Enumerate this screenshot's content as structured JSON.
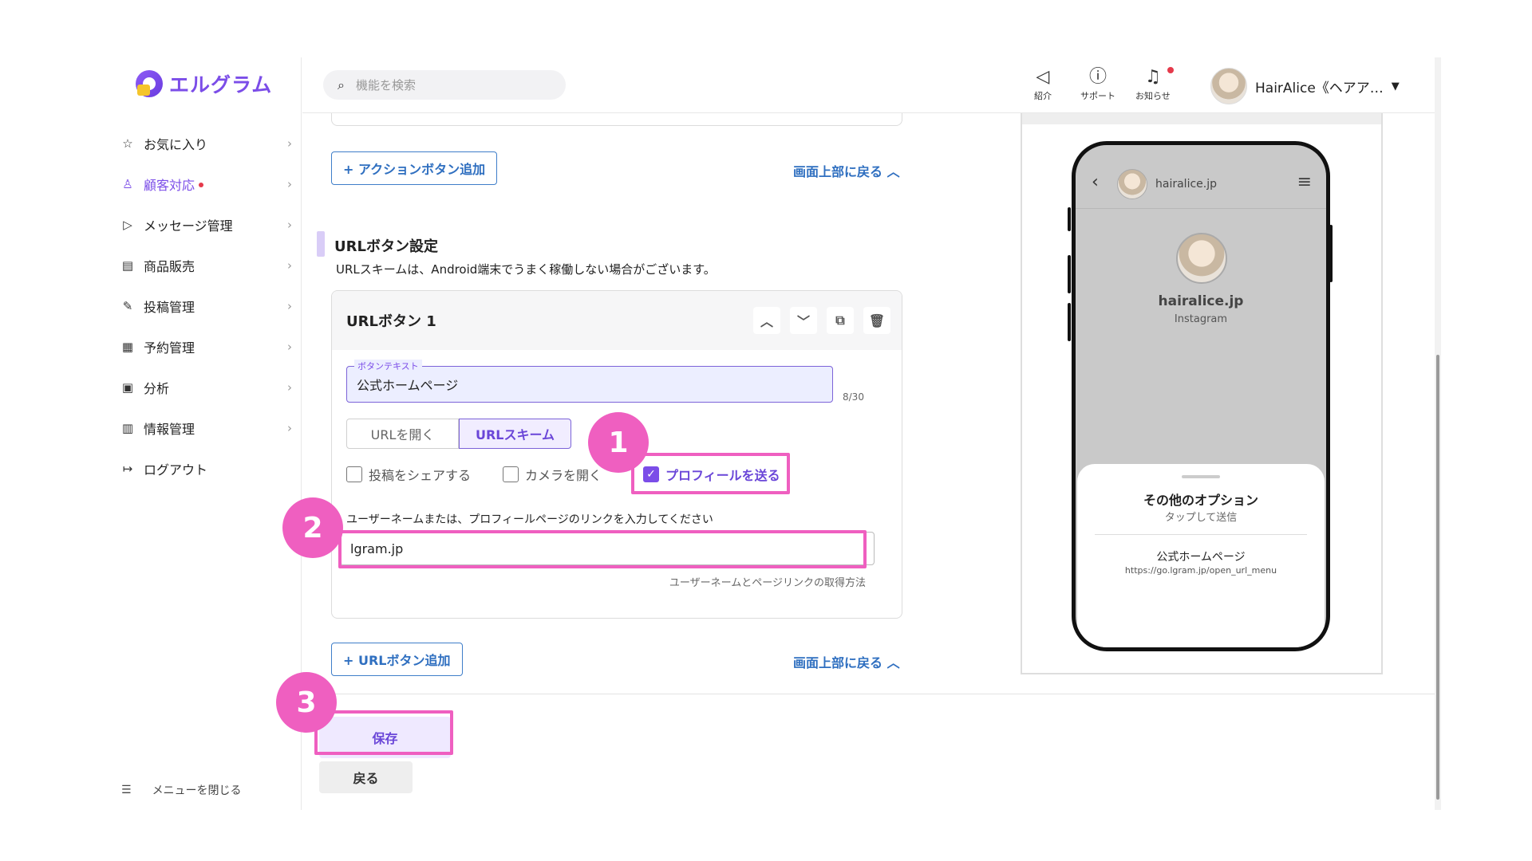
{
  "brand": {
    "name": "エルグラム"
  },
  "sidebar": {
    "items": [
      {
        "label": "お気に入り",
        "icon": "star-icon",
        "glyph": "☆"
      },
      {
        "label": "顧客対応",
        "icon": "user-icon",
        "glyph": "♙",
        "active": true,
        "dot": true
      },
      {
        "label": "メッセージ管理",
        "icon": "send-icon",
        "glyph": "▷"
      },
      {
        "label": "商品販売",
        "icon": "store-icon",
        "glyph": "▤"
      },
      {
        "label": "投稿管理",
        "icon": "edit-icon",
        "glyph": "✎"
      },
      {
        "label": "予約管理",
        "icon": "calendar-icon",
        "glyph": "▦"
      },
      {
        "label": "分析",
        "icon": "report-icon",
        "glyph": "▣"
      },
      {
        "label": "情報管理",
        "icon": "chart-icon",
        "glyph": "▥"
      },
      {
        "label": "ログアウト",
        "icon": "logout-icon",
        "glyph": "↦"
      }
    ],
    "close_menu": "メニューを閉じる"
  },
  "header": {
    "search_placeholder": "機能を検索",
    "icons": [
      {
        "label": "紹介",
        "icon": "megaphone-icon"
      },
      {
        "label": "サポート",
        "icon": "help-icon"
      },
      {
        "label": "お知らせ",
        "icon": "bell-icon"
      }
    ],
    "user_name": "HairAlice《ヘアア…"
  },
  "main": {
    "add_action_button": "+ アクションボタン追加",
    "back_to_top": "画面上部に戻る",
    "section_title": "URLボタン設定",
    "section_desc": "URLスキームは、Android端末でうまく稼働しない場合がございます。",
    "card_title": "URLボタン 1",
    "button_text_label": "ボタンテキスト",
    "button_text_value": "公式ホームページ",
    "counter": "8/30",
    "seg_open_url": "URLを開く",
    "seg_url_scheme": "URLスキーム",
    "chk_share_post": "投稿をシェアする",
    "chk_open_camera": "カメラを開く",
    "chk_send_profile": "プロフィールを送る",
    "username_hint": "ユーザーネームまたは、プロフィールページのリンクを入力してください",
    "username_value": "lgram.jp",
    "help_link": "ユーザーネームとページリンクの取得方法",
    "add_url_button": "+ URLボタン追加",
    "save": "保存",
    "back": "戻る"
  },
  "annotations": {
    "step1": "1",
    "step2": "2",
    "step3": "3",
    "color": "#ef5fc0"
  },
  "preview": {
    "handle": "hairalice.jp",
    "profile_name": "hairalice.jp",
    "profile_sub": "Instagram",
    "sheet_title": "その他のオプション",
    "sheet_sub": "タップして送信",
    "item_title": "公式ホームページ",
    "item_url": "https://go.lgram.jp/open_url_menu"
  }
}
